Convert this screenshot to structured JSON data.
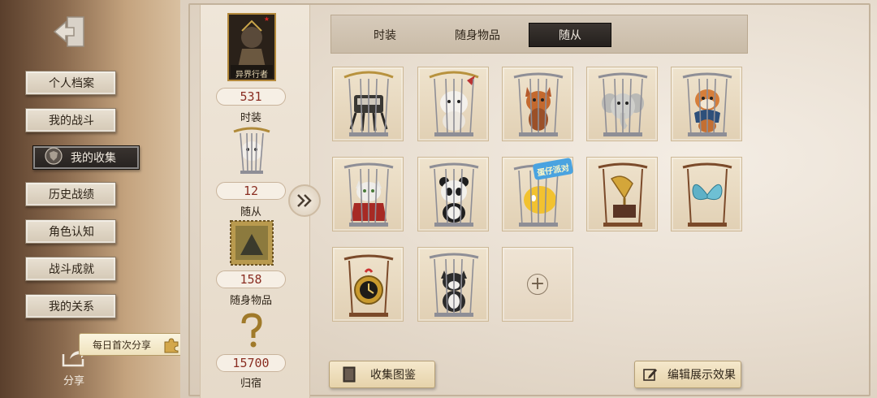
{
  "menu": {
    "items": [
      {
        "label": "个人档案",
        "active": false
      },
      {
        "label": "我的战斗",
        "active": false
      },
      {
        "label": "我的收集",
        "active": true
      },
      {
        "label": "历史战绩",
        "active": false
      },
      {
        "label": "角色认知",
        "active": false
      },
      {
        "label": "战斗成就",
        "active": false
      },
      {
        "label": "我的关系",
        "active": false
      }
    ],
    "share_tip": "每日首次分享",
    "share_label": "分享"
  },
  "stats": {
    "costume": {
      "badge_text": "异界行者",
      "count": "531",
      "label": "时装"
    },
    "follower": {
      "count": "12",
      "label": "随从"
    },
    "accessory": {
      "count": "158",
      "label": "随身物品"
    },
    "home": {
      "count": "15700",
      "label": "归宿"
    }
  },
  "tabs": [
    {
      "label": "时装",
      "active": false
    },
    {
      "label": "随身物品",
      "active": false
    },
    {
      "label": "随从",
      "active": true
    }
  ],
  "followers": [
    {
      "name": "mechanical-spider-follower"
    },
    {
      "name": "white-dog-follower"
    },
    {
      "name": "fox-follower"
    },
    {
      "name": "elephant-follower"
    },
    {
      "name": "shiba-dog-follower"
    },
    {
      "name": "white-cat-red-cloak-follower"
    },
    {
      "name": "panda-follower"
    },
    {
      "name": "yellow-egg-follower",
      "tag": "蛋仔派对"
    },
    {
      "name": "gramophone-follower"
    },
    {
      "name": "blue-butterfly-follower"
    },
    {
      "name": "gold-clock-follower"
    },
    {
      "name": "tuxedo-cat-follower"
    }
  ],
  "bottom": {
    "gallery_label": "收集图鉴",
    "edit_label": "编辑展示效果"
  },
  "colors": {
    "accent_red": "#8a2e22",
    "active_tab": "#24201d",
    "paper": "#ede4d8"
  }
}
